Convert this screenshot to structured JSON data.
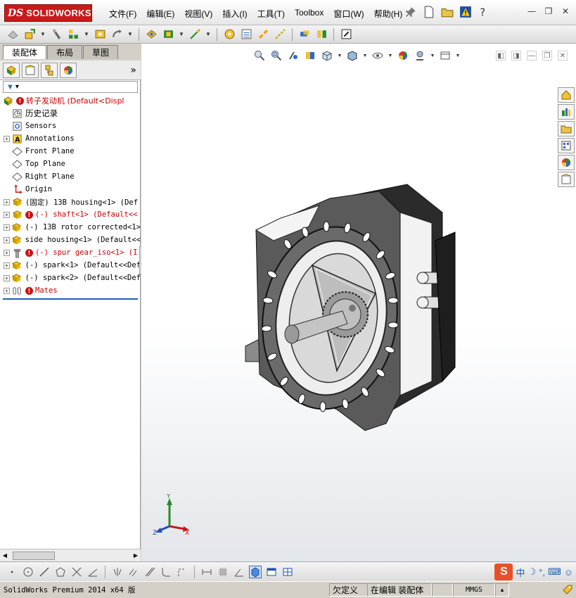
{
  "app": {
    "logo_ds": "DS",
    "logo_name": "SOLIDWORKS"
  },
  "menu": {
    "items": [
      "文件(F)",
      "编辑(E)",
      "视图(V)",
      "插入(I)",
      "工具(T)",
      "Toolbox",
      "窗口(W)",
      "帮助(H)"
    ]
  },
  "window_controls": {
    "minimize": "—",
    "restore": "❐",
    "close": "✕"
  },
  "left_panel": {
    "tabs": [
      "装配体",
      "布局",
      "草图"
    ],
    "active_tab": "装配体",
    "more": "»",
    "filter_placeholder": "▾",
    "tree": [
      {
        "label": "转子发动机  (Default<Displ",
        "icon": "assembly-icon",
        "warn": true,
        "root": true
      },
      {
        "label": "历史记录",
        "icon": "history-icon"
      },
      {
        "label": "Sensors",
        "icon": "sensors-icon"
      },
      {
        "label": "Annotations",
        "icon": "annotations-icon",
        "expand": "+"
      },
      {
        "label": "Front Plane",
        "icon": "plane-icon"
      },
      {
        "label": "Top Plane",
        "icon": "plane-icon"
      },
      {
        "label": "Right Plane",
        "icon": "plane-icon"
      },
      {
        "label": "Origin",
        "icon": "origin-icon"
      },
      {
        "label": "(固定) 13B housing<1> (Def",
        "icon": "part-icon",
        "expand": "+"
      },
      {
        "label": "(-) shaft<1> (Default<<",
        "icon": "part-icon",
        "expand": "+",
        "warn": true,
        "red": true
      },
      {
        "label": "(-) 13B rotor corrected<1>",
        "icon": "part-icon",
        "expand": "+"
      },
      {
        "label": "side housing<1> (Default<<",
        "icon": "part-icon",
        "expand": "+"
      },
      {
        "label": "(-) spur gear_iso<1> (I",
        "icon": "toolbox-part-icon",
        "expand": "+",
        "warn": true,
        "red": true
      },
      {
        "label": "(-) spark<1> (Default<<Def",
        "icon": "part-icon",
        "expand": "+"
      },
      {
        "label": "(-) spark<2> (Default<<Def",
        "icon": "part-icon",
        "expand": "+"
      },
      {
        "label": "Mates",
        "icon": "mates-icon",
        "expand": "+",
        "warn": true,
        "red": true
      }
    ]
  },
  "graphics": {
    "viewport_controls": [
      "◧",
      "◨",
      "—",
      "❐",
      "✕"
    ]
  },
  "triad": {
    "x": "X",
    "y": "Y",
    "z": "Z"
  },
  "ime": {
    "logo": "S",
    "lang": "中"
  },
  "status": {
    "product": "SolidWorks Premium 2014 x64 版",
    "underdefined": "欠定义",
    "editing": "在编辑 装配体",
    "units": "MMGS",
    "units_arrow": "▴"
  },
  "colors": {
    "brand": "#c81a1a",
    "error": "#cc0000",
    "selection_line": "#1f5fb5"
  }
}
